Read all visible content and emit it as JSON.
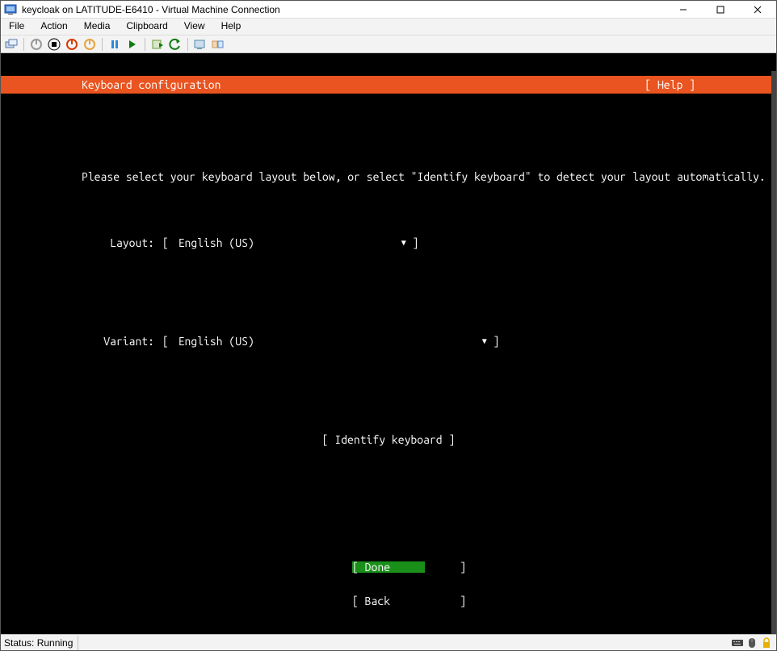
{
  "window": {
    "title": "keycloak on LATITUDE-E6410 - Virtual Machine Connection"
  },
  "menubar": {
    "items": [
      "File",
      "Action",
      "Media",
      "Clipboard",
      "View",
      "Help"
    ]
  },
  "toolbar": {
    "icons": [
      "ctrl-alt-del",
      "start-grey",
      "stop",
      "turnoff",
      "shutdown",
      "pause",
      "play",
      "checkpoint",
      "revert",
      "enhanced",
      "share"
    ]
  },
  "terminal": {
    "header_title": "Keyboard configuration",
    "help": "[ Help ]",
    "instruction": "Please select your keyboard layout below, or select \"Identify keyboard\" to detect your layout automatically.",
    "layout_label": "Layout:",
    "layout_value": "English (US)",
    "variant_label": "Variant:",
    "variant_value": "English (US)",
    "identify_button": "[ Identify keyboard ]",
    "done_button": "[ Done           ]",
    "back_button": "[ Back           ]"
  },
  "statusbar": {
    "text": "Status: Running"
  }
}
